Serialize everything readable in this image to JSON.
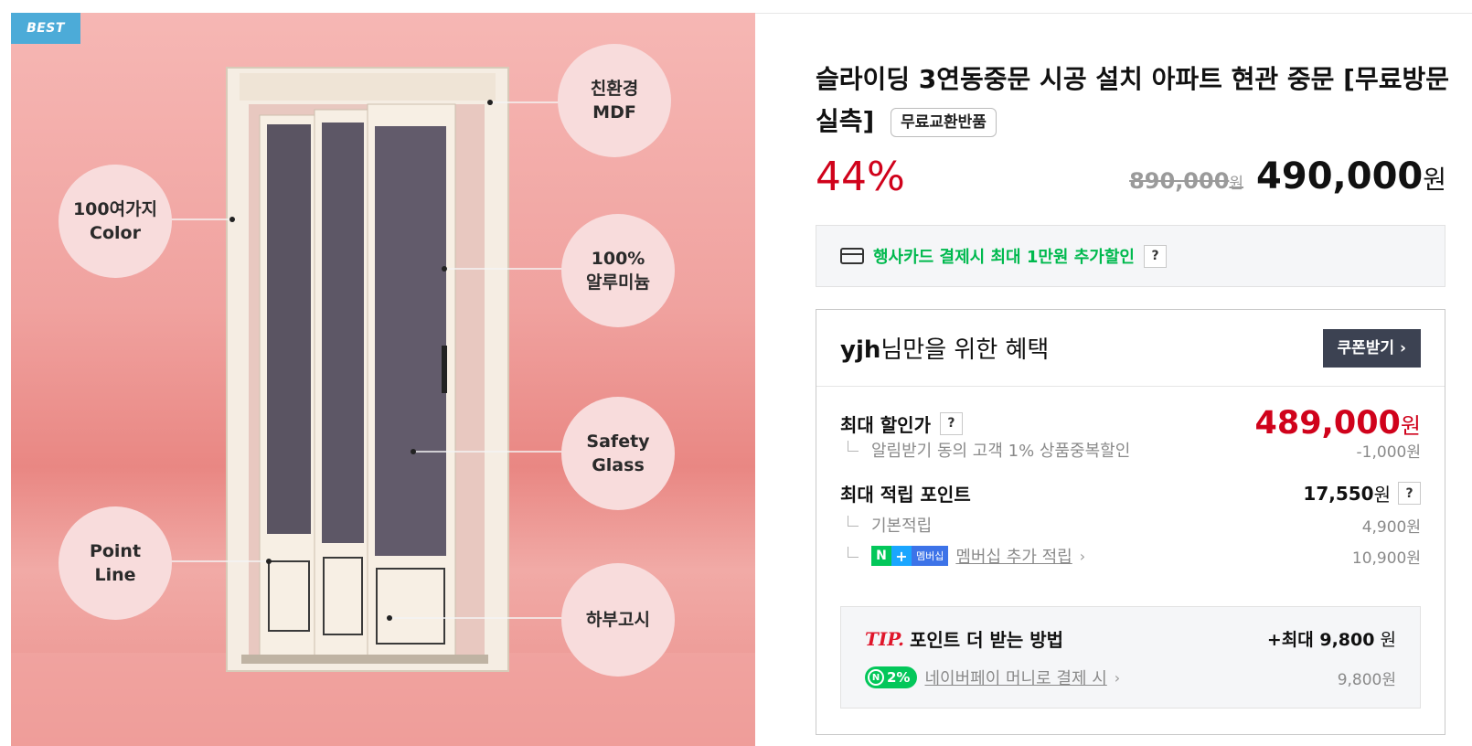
{
  "image": {
    "badge": "BEST",
    "callouts": [
      {
        "id": "eco",
        "text": "친환경\nMDF"
      },
      {
        "id": "color",
        "text": "100여가지\nColor"
      },
      {
        "id": "aluminum",
        "text": "100%\n알루미늄"
      },
      {
        "id": "glass",
        "text": "Safety\nGlass"
      },
      {
        "id": "point",
        "text": "Point\nLine"
      },
      {
        "id": "lower",
        "text": "하부고시"
      }
    ]
  },
  "product": {
    "title": "슬라이딩 3연동중문 시공 설치 아파트 현관 중문 [무료방문실측]",
    "tag": "무료교환반품",
    "discount": "44%",
    "original_price": "890,000",
    "original_unit": "원",
    "sale_price": "490,000",
    "sale_unit": "원"
  },
  "card_promo": {
    "icon": "credit-card-icon",
    "text": "행사카드 결제시 최대 1만원 추가할인",
    "help": "?"
  },
  "benefit": {
    "title_user": "yjh",
    "title_rest": "님만을 위한 혜택",
    "coupon_button": "쿠폰받기 ›",
    "max_discount_label": "최대 할인가",
    "max_discount_help": "?",
    "max_discount_price": "489,000",
    "max_discount_unit": "원",
    "max_discount_sub_label": "알림받기 동의 고객 1% 상품중복할인",
    "max_discount_sub_value": "-1,000원",
    "points_label": "최대 적립 포인트",
    "points_value": "17,550",
    "points_unit": "원",
    "points_help": "?",
    "base_points_label": "기본적립",
    "base_points_value": "4,900원",
    "membership_badge_n": "N",
    "membership_badge_plus": "+",
    "membership_badge_text": "멤버십",
    "membership_label": "멤버십 추가 적립",
    "membership_value": "10,900원",
    "tip": {
      "tip_word": "TIP.",
      "label": "포인트 더 받는 방법",
      "max_prefix": "+최대 ",
      "max_value": "9,800",
      "max_unit": " 원",
      "npay_pill": "2%",
      "npay_label": "네이버페이 머니로 결제 시",
      "npay_value": "9,800원"
    }
  },
  "colors": {
    "discount_red": "#d0021b",
    "green": "#00b94e",
    "coupon_button_bg": "#3c4252",
    "best_badge": "#4cabd8"
  }
}
